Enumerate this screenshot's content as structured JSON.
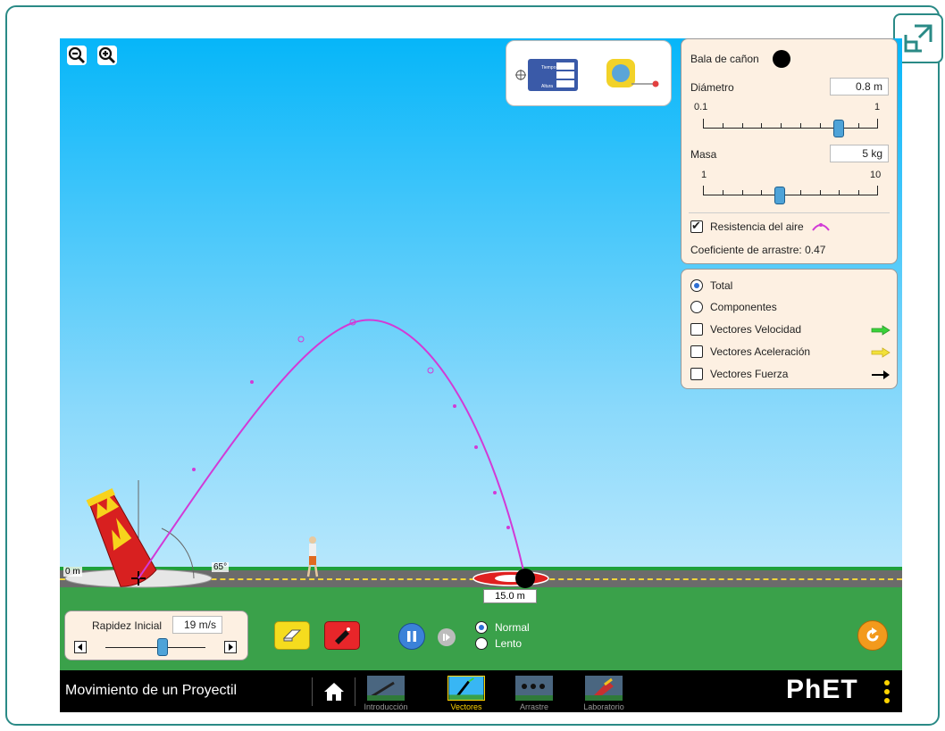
{
  "app": {
    "title": "Movimiento de un Proyectil",
    "brand": "PhET"
  },
  "projectile_panel": {
    "projectile_name": "Bala de cañon",
    "diameter_label": "Diámetro",
    "diameter_value": "0.8 m",
    "diameter_min": "0.1",
    "diameter_max": "1",
    "mass_label": "Masa",
    "mass_value": "5 kg",
    "mass_min": "1",
    "mass_max": "10",
    "air_resistance_label": "Resistencia del aire",
    "air_resistance_checked": true,
    "drag_coefficient_text": "Coeficiente de arrastre: 0.47"
  },
  "vectors_panel": {
    "total_label": "Total",
    "components_label": "Componentes",
    "selected": "Total",
    "velocity_label": "Vectores Velocidad",
    "acceleration_label": "Vectores Aceleración",
    "force_label": "Vectores Fuerza",
    "velocity_color": "#3ad23a",
    "acceleration_color": "#f2e13a",
    "force_color": "#000000"
  },
  "tools_panel": {
    "tracer_rows": [
      "Tiempo",
      "",
      "Altura"
    ]
  },
  "scene": {
    "origin_label": "0 m",
    "angle_label": "65°",
    "landing_distance": "15.0 m",
    "trajectory_color": "#d23ad6"
  },
  "launch_controls": {
    "speed_label": "Rapidez Inicial",
    "speed_value": "19 m/s",
    "speed_fraction": 0.58
  },
  "playback": {
    "normal_label": "Normal",
    "slow_label": "Lento",
    "selected": "Normal"
  },
  "nav_tabs": [
    {
      "label": "Introducción",
      "active": false
    },
    {
      "label": "Vectores",
      "active": true
    },
    {
      "label": "Arrastre",
      "active": false
    },
    {
      "label": "Laboratorio",
      "active": false
    }
  ]
}
